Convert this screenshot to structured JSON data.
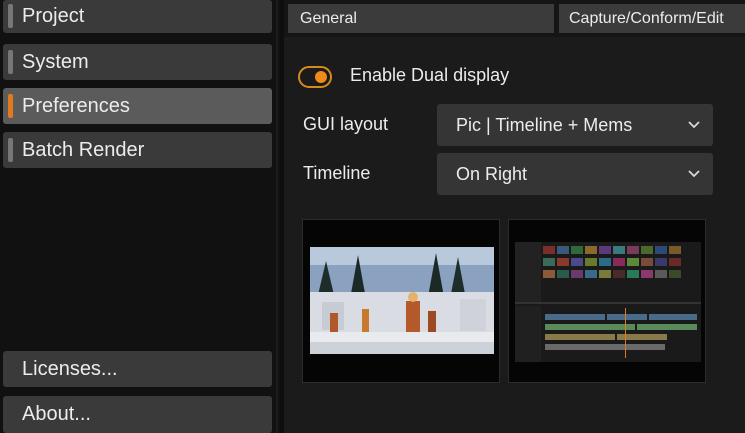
{
  "sidebar": {
    "items": [
      {
        "label": "Project",
        "active": false
      },
      {
        "label": "System",
        "active": false
      },
      {
        "label": "Preferences",
        "active": true
      },
      {
        "label": "Batch Render",
        "active": false
      }
    ],
    "bottom_items": [
      {
        "label": "Licenses..."
      },
      {
        "label": "About..."
      }
    ]
  },
  "tabs": [
    {
      "label": "General",
      "active": true
    },
    {
      "label": "Capture/Conform/Edit",
      "active": false
    }
  ],
  "general": {
    "dual_display": {
      "label": "Enable Dual display",
      "enabled": true
    },
    "gui_layout": {
      "label": "GUI layout",
      "value": "Pic | Timeline + Mems"
    },
    "timeline": {
      "label": "Timeline",
      "value": "On Right"
    }
  },
  "thumbnails": [
    {
      "icon": "picture-preview-thumbnail"
    },
    {
      "icon": "timeline-mems-preview-thumbnail"
    }
  ],
  "colors": {
    "accent": "#f08a18",
    "panel": "#1b1b1b",
    "button": "#3a3a3a"
  }
}
